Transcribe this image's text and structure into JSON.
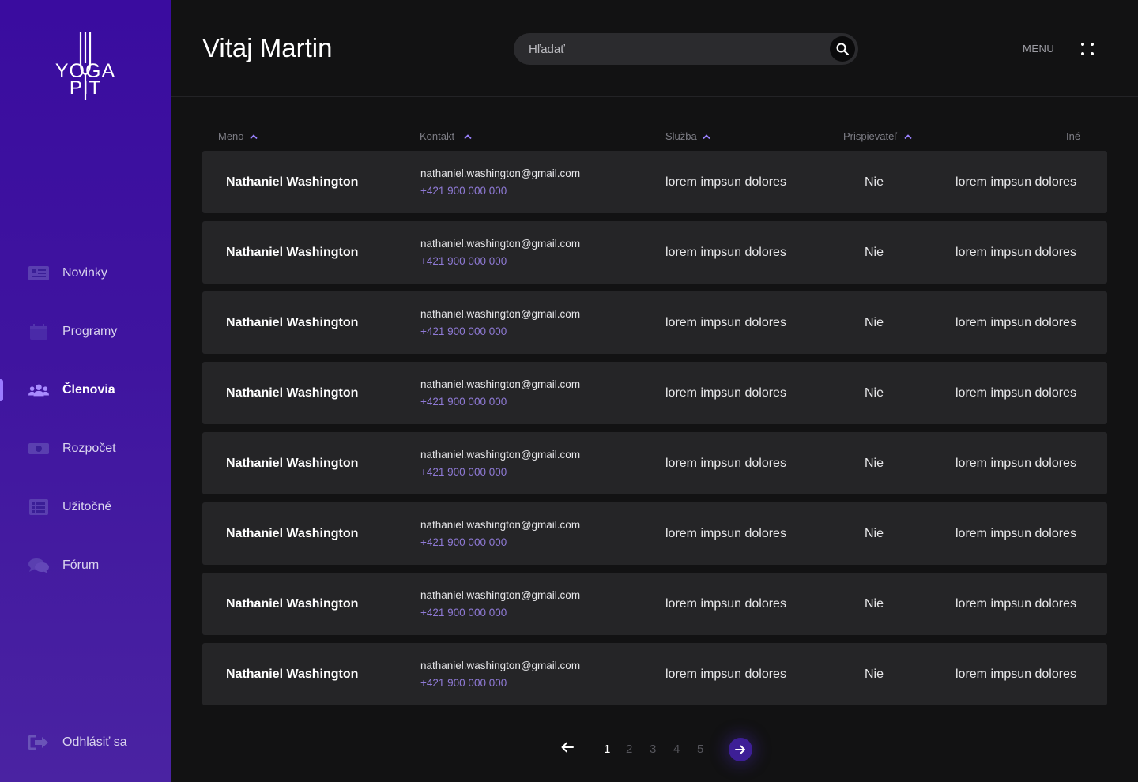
{
  "brand": {
    "logo_line1": "YOGA",
    "logo_line2": "PIT"
  },
  "header": {
    "greeting": "Vitaj Martin",
    "search_placeholder": "Hľadať",
    "menu_label": "MENU"
  },
  "sidebar": {
    "items": [
      {
        "label": "Novinky",
        "icon": "newspaper-icon",
        "active": false
      },
      {
        "label": "Programy",
        "icon": "calendar-icon",
        "active": false
      },
      {
        "label": "Členovia",
        "icon": "users-icon",
        "active": true
      },
      {
        "label": "Rozpočet",
        "icon": "money-icon",
        "active": false
      },
      {
        "label": "Užitočné",
        "icon": "list-icon",
        "active": false
      },
      {
        "label": "Fórum",
        "icon": "comments-icon",
        "active": false
      }
    ],
    "logout_label": "Odhlásiť sa"
  },
  "table": {
    "columns": [
      "Meno",
      "Kontakt",
      "Služba",
      "Prispievateľ",
      "Iné"
    ],
    "rows": [
      {
        "name": "Nathaniel Washington",
        "email": "nathaniel.washington@gmail.com",
        "phone": "+421 900 000 000",
        "service": "lorem impsun dolores",
        "contributor": "Nie",
        "other": "lorem impsun dolores"
      },
      {
        "name": "Nathaniel Washington",
        "email": "nathaniel.washington@gmail.com",
        "phone": "+421 900 000 000",
        "service": "lorem impsun dolores",
        "contributor": "Nie",
        "other": "lorem impsun dolores"
      },
      {
        "name": "Nathaniel Washington",
        "email": "nathaniel.washington@gmail.com",
        "phone": "+421 900 000 000",
        "service": "lorem impsun dolores",
        "contributor": "Nie",
        "other": "lorem impsun dolores"
      },
      {
        "name": "Nathaniel Washington",
        "email": "nathaniel.washington@gmail.com",
        "phone": "+421 900 000 000",
        "service": "lorem impsun dolores",
        "contributor": "Nie",
        "other": "lorem impsun dolores"
      },
      {
        "name": "Nathaniel Washington",
        "email": "nathaniel.washington@gmail.com",
        "phone": "+421 900 000 000",
        "service": "lorem impsun dolores",
        "contributor": "Nie",
        "other": "lorem impsun dolores"
      },
      {
        "name": "Nathaniel Washington",
        "email": "nathaniel.washington@gmail.com",
        "phone": "+421 900 000 000",
        "service": "lorem impsun dolores",
        "contributor": "Nie",
        "other": "lorem impsun dolores"
      },
      {
        "name": "Nathaniel Washington",
        "email": "nathaniel.washington@gmail.com",
        "phone": "+421 900 000 000",
        "service": "lorem impsun dolores",
        "contributor": "Nie",
        "other": "lorem impsun dolores"
      },
      {
        "name": "Nathaniel Washington",
        "email": "nathaniel.washington@gmail.com",
        "phone": "+421 900 000 000",
        "service": "lorem impsun dolores",
        "contributor": "Nie",
        "other": "lorem impsun dolores"
      }
    ]
  },
  "pagination": {
    "pages": [
      "1",
      "2",
      "3",
      "4",
      "5"
    ],
    "current": "1"
  },
  "colors": {
    "sidebar_top": "#3a0c9f",
    "sidebar_bottom": "#4a23a2",
    "background": "#121213",
    "row": "#252527",
    "accent": "#8f7ad6"
  }
}
